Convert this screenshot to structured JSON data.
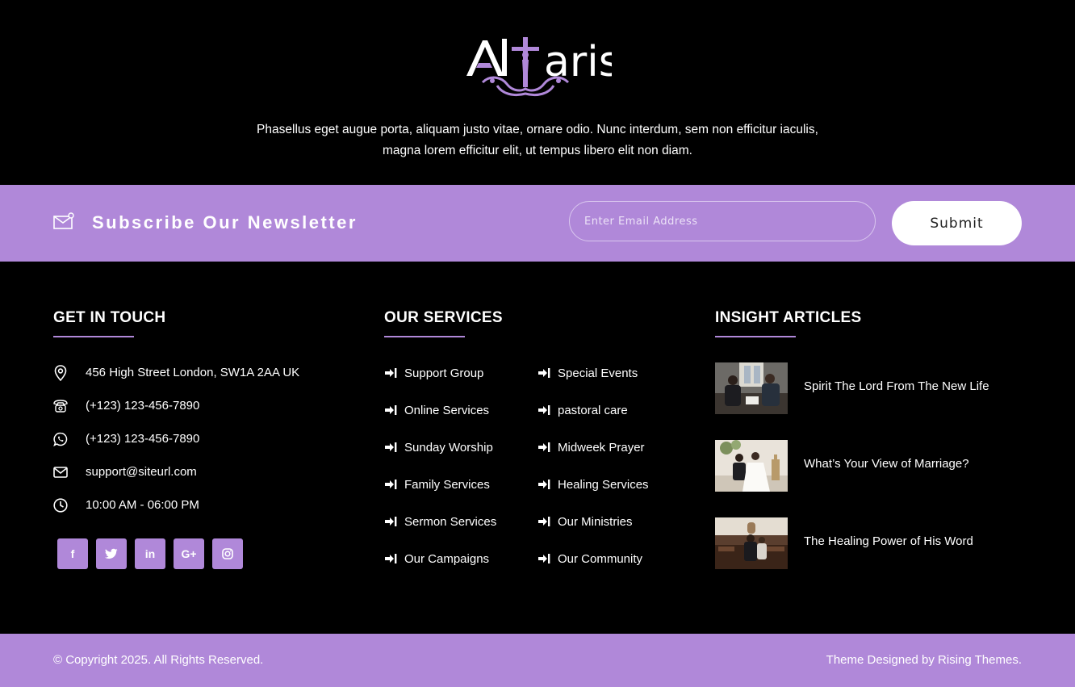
{
  "brand": {
    "logo_text": "Altaris",
    "tagline": "Phasellus eget augue porta, aliquam justo vitae, ornare odio. Nunc interdum, sem non efficitur iaculis, magna lorem efficitur elit, ut tempus libero elit non diam."
  },
  "newsletter": {
    "title": "Subscribe Our Newsletter",
    "email_placeholder": "Enter Email Address",
    "submit_label": "Submit",
    "icon": "envelope-icon"
  },
  "contact": {
    "heading": "GET IN TOUCH",
    "items": [
      {
        "icon": "map-pin-icon",
        "text": "456 High Street London, SW1A 2AA UK"
      },
      {
        "icon": "phone-icon",
        "text": "(+123) 123-456-7890"
      },
      {
        "icon": "whatsapp-icon",
        "text": "(+123) 123-456-7890"
      },
      {
        "icon": "envelope-icon",
        "text": "support@siteurl.com"
      },
      {
        "icon": "clock-icon",
        "text": "10:00 AM - 06:00 PM"
      }
    ],
    "social": [
      {
        "icon": "facebook-icon",
        "glyph": "f"
      },
      {
        "icon": "twitter-icon",
        "glyph": "t"
      },
      {
        "icon": "linkedin-icon",
        "glyph": "in"
      },
      {
        "icon": "google-plus-icon",
        "glyph": "G+"
      },
      {
        "icon": "instagram-icon",
        "glyph": "◎"
      }
    ]
  },
  "services": {
    "heading": "OUR SERVICES",
    "left": [
      "Support Group",
      "Online Services",
      "Sunday Worship",
      "Family Services",
      "Sermon Services",
      "Our Campaigns"
    ],
    "right": [
      "Special Events",
      "pastoral care",
      "Midweek Prayer",
      "Healing Services",
      "Our Ministries",
      "Our Community"
    ]
  },
  "articles": {
    "heading": "INSIGHT ARTICLES",
    "items": [
      {
        "title": "Spirit The Lord From The New Life"
      },
      {
        "title": "What’s Your View of Marriage?"
      },
      {
        "title": "The Healing Power of His Word"
      }
    ]
  },
  "footer": {
    "copyright": "© Copyright 2025. All Rights Reserved.",
    "credit": "Theme Designed by Rising Themes."
  },
  "colors": {
    "accent": "#b088d9",
    "background": "#000000",
    "text": "#ffffff"
  }
}
